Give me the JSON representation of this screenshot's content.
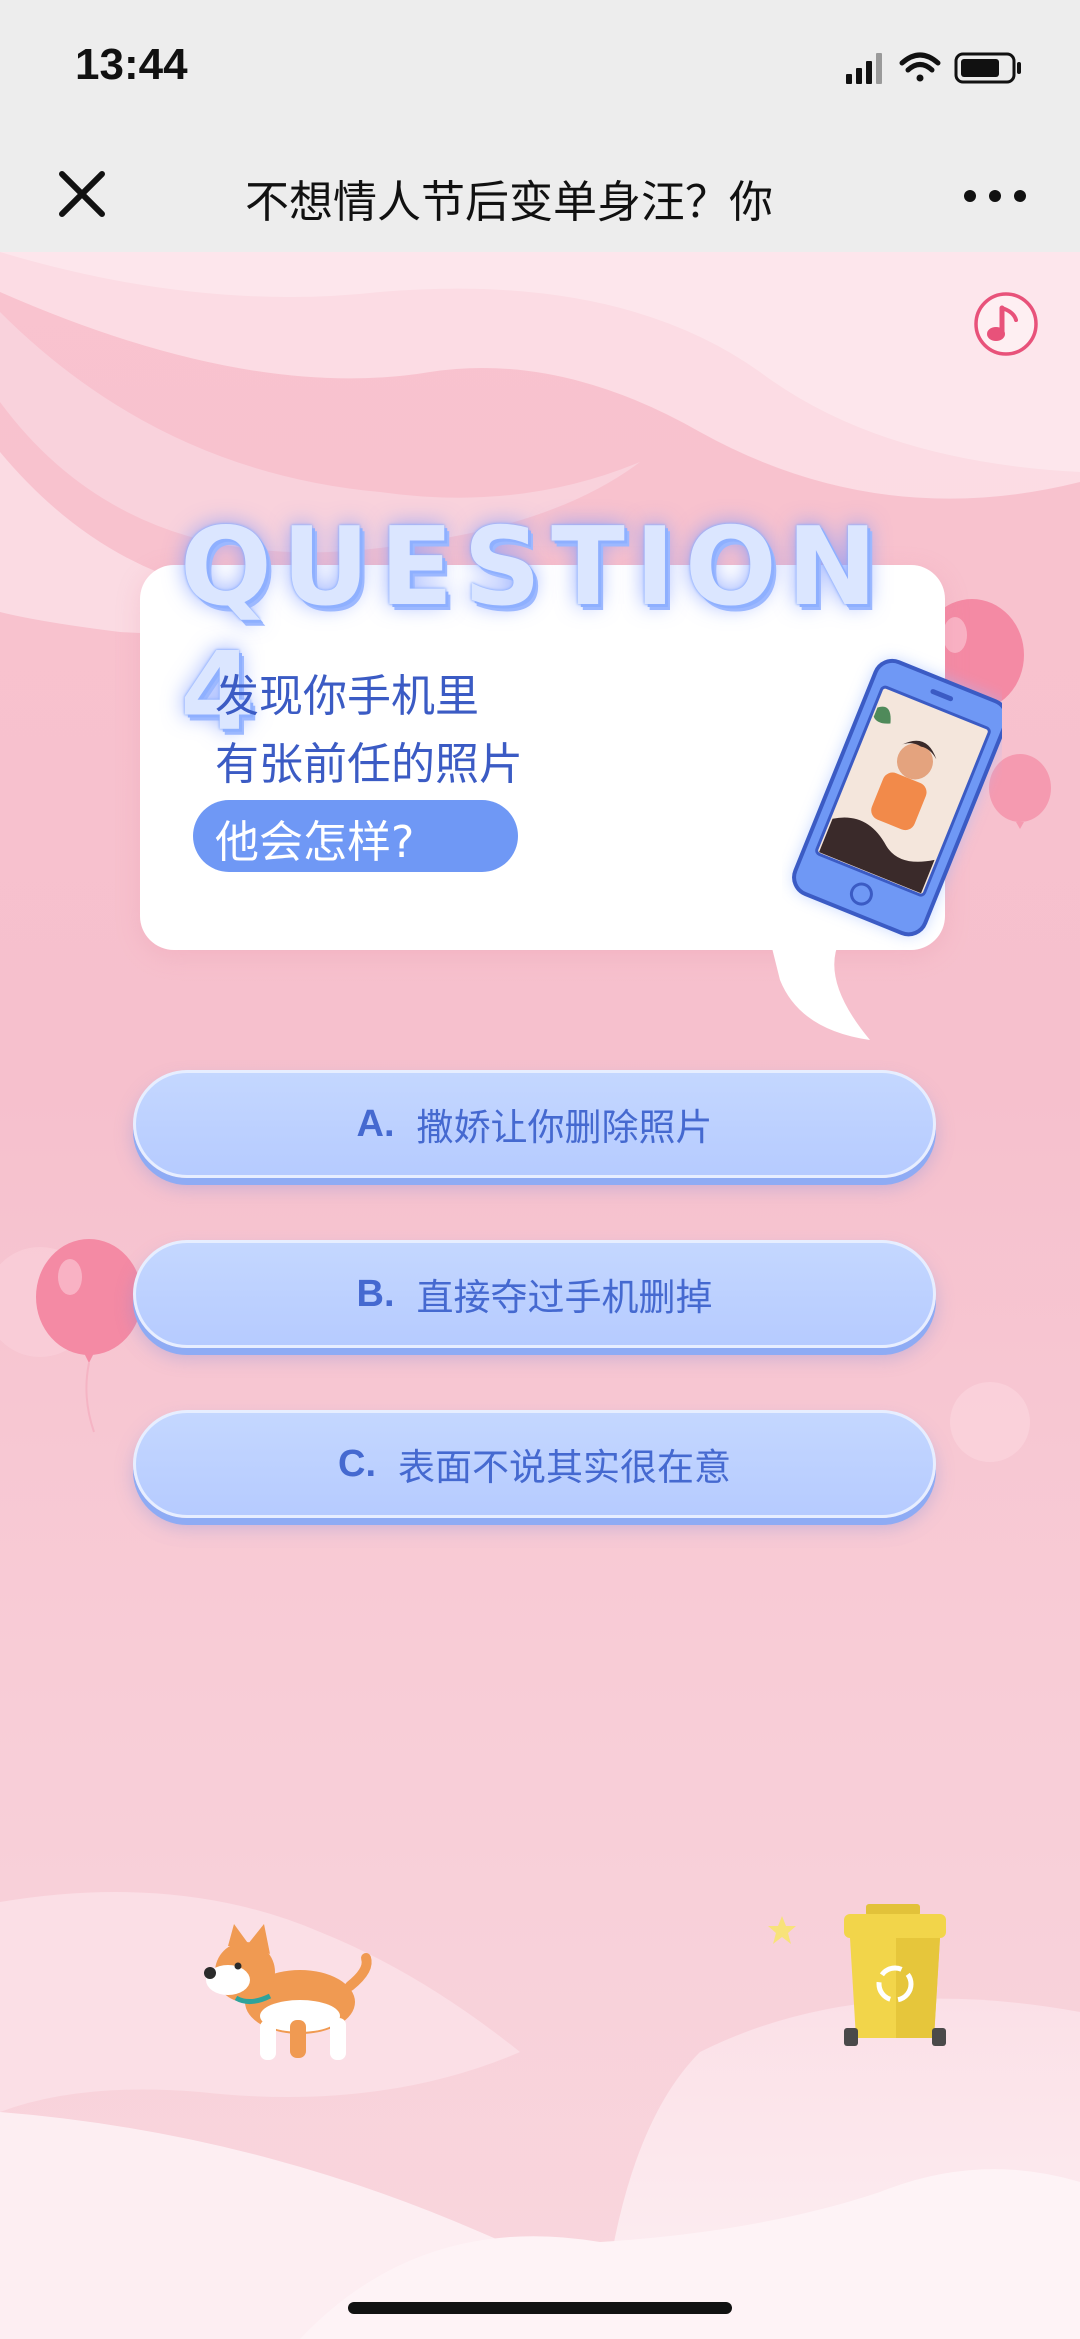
{
  "status_bar": {
    "time": "13:44"
  },
  "nav": {
    "title": "不想情人节后变单身汪？你",
    "close_icon": "close-icon",
    "more_icon": "more-dots-icon"
  },
  "quiz": {
    "heading": "QUESTION 4",
    "question_lines": [
      "发现你手机里",
      "有张前任的照片",
      "他会怎样?"
    ],
    "options": [
      {
        "letter": "A.",
        "text": "撒娇让你删除照片"
      },
      {
        "letter": "B.",
        "text": "直接夺过手机删掉"
      },
      {
        "letter": "C.",
        "text": "表面不说其实很在意"
      }
    ]
  },
  "icons": {
    "music": "music-note-icon",
    "phone": "phone-illustration",
    "dog": "corgi-illustration",
    "bin": "recycle-bin-illustration",
    "balloon": "balloon-icon"
  },
  "colors": {
    "accent": "#6f98f5",
    "option_bg": "#b9ceff",
    "option_text": "#4569d0",
    "question_text": "#3b5bc4",
    "background": "#f7c4d1",
    "music_icon": "#e8527a"
  }
}
